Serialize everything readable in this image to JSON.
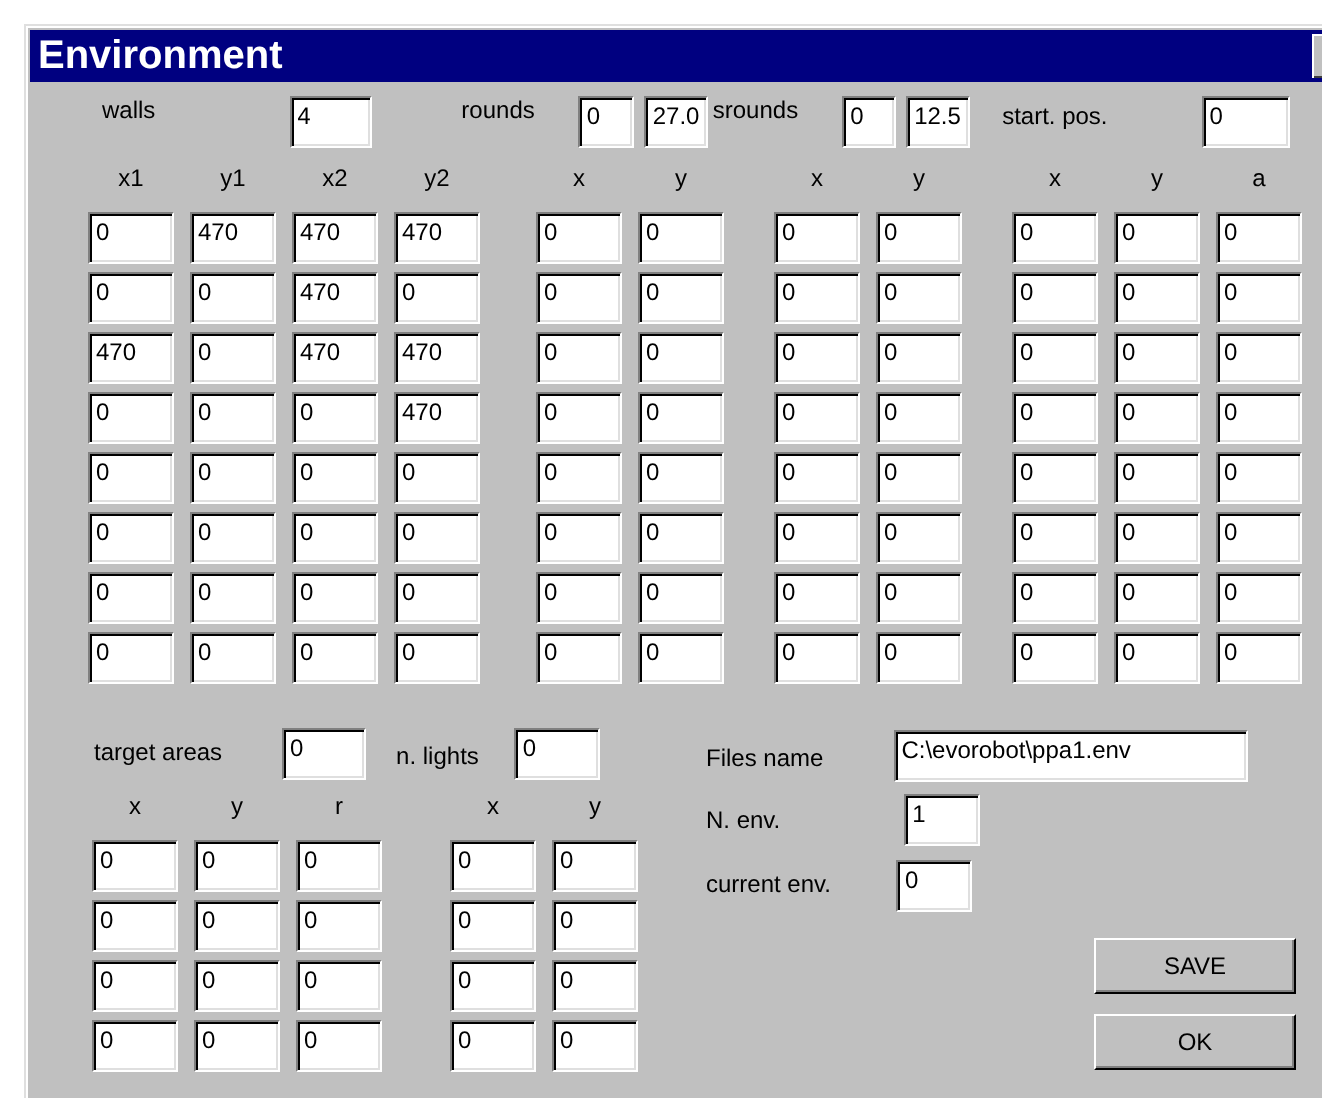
{
  "window": {
    "title": "Environment"
  },
  "walls": {
    "label": "walls",
    "value": "4"
  },
  "rounds": {
    "label": "rounds",
    "values": [
      "0",
      "27.0"
    ]
  },
  "srounds": {
    "label": "srounds",
    "values": [
      "0",
      "12.5"
    ]
  },
  "start_pos": {
    "label": "start. pos.",
    "value": "0"
  },
  "tables": [
    {
      "columns": [
        "x1",
        "y1",
        "x2",
        "y2"
      ],
      "rows": [
        [
          "0",
          "470",
          "470",
          "470"
        ],
        [
          "0",
          "0",
          "470",
          "0"
        ],
        [
          "470",
          "0",
          "470",
          "470"
        ],
        [
          "0",
          "0",
          "0",
          "470"
        ],
        [
          "0",
          "0",
          "0",
          "0"
        ],
        [
          "0",
          "0",
          "0",
          "0"
        ],
        [
          "0",
          "0",
          "0",
          "0"
        ],
        [
          "0",
          "0",
          "0",
          "0"
        ]
      ]
    },
    {
      "columns": [
        "x",
        "y"
      ],
      "rows": [
        [
          "0",
          "0"
        ],
        [
          "0",
          "0"
        ],
        [
          "0",
          "0"
        ],
        [
          "0",
          "0"
        ],
        [
          "0",
          "0"
        ],
        [
          "0",
          "0"
        ],
        [
          "0",
          "0"
        ],
        [
          "0",
          "0"
        ]
      ]
    },
    {
      "columns": [
        "x",
        "y"
      ],
      "rows": [
        [
          "0",
          "0"
        ],
        [
          "0",
          "0"
        ],
        [
          "0",
          "0"
        ],
        [
          "0",
          "0"
        ],
        [
          "0",
          "0"
        ],
        [
          "0",
          "0"
        ],
        [
          "0",
          "0"
        ],
        [
          "0",
          "0"
        ]
      ]
    },
    {
      "columns": [
        "x",
        "y",
        "a"
      ],
      "rows": [
        [
          "0",
          "0",
          "0"
        ],
        [
          "0",
          "0",
          "0"
        ],
        [
          "0",
          "0",
          "0"
        ],
        [
          "0",
          "0",
          "0"
        ],
        [
          "0",
          "0",
          "0"
        ],
        [
          "0",
          "0",
          "0"
        ],
        [
          "0",
          "0",
          "0"
        ],
        [
          "0",
          "0",
          "0"
        ]
      ]
    }
  ],
  "target_areas": {
    "label": "target areas",
    "value": "0",
    "columns": [
      "x",
      "y",
      "r"
    ],
    "rows": [
      [
        "0",
        "0",
        "0"
      ],
      [
        "0",
        "0",
        "0"
      ],
      [
        "0",
        "0",
        "0"
      ],
      [
        "0",
        "0",
        "0"
      ]
    ]
  },
  "lights": {
    "label": "n. lights",
    "value": "0",
    "columns": [
      "x",
      "y"
    ],
    "rows": [
      [
        "0",
        "0"
      ],
      [
        "0",
        "0"
      ],
      [
        "0",
        "0"
      ],
      [
        "0",
        "0"
      ]
    ]
  },
  "files_name": {
    "label": "Files name",
    "value": "C:\\evorobot\\ppa1.env"
  },
  "n_env": {
    "label": "N. env.",
    "value": "1"
  },
  "current_env": {
    "label": "current env.",
    "value": "0"
  },
  "buttons": [
    "SAVE",
    "OK"
  ]
}
